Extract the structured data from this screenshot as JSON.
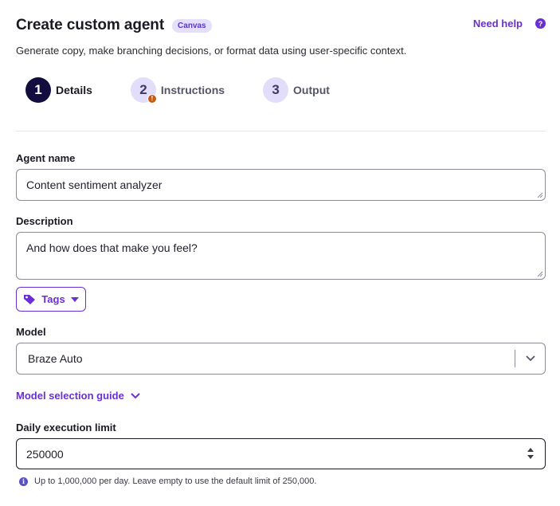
{
  "header": {
    "title": "Create custom agent",
    "badge": "Canvas",
    "help_link": "Need help",
    "help_icon": "?"
  },
  "subtitle": "Generate copy, make branching decisions, or format data using user-specific context.",
  "steps": [
    {
      "number": "1",
      "label": "Details",
      "active": true
    },
    {
      "number": "2",
      "label": "Instructions",
      "active": false,
      "warning": "!"
    },
    {
      "number": "3",
      "label": "Output",
      "active": false
    }
  ],
  "form": {
    "agent_name": {
      "label": "Agent name",
      "value": "Content sentiment analyzer"
    },
    "description": {
      "label": "Description",
      "value": "And how does that make you feel?"
    },
    "tags_button": "Tags",
    "model": {
      "label": "Model",
      "value": "Braze Auto"
    },
    "model_guide_link": "Model selection guide",
    "daily_limit": {
      "label": "Daily execution limit",
      "value": "250000",
      "hint": "Up to 1,000,000 per day. Leave empty to use the default limit of 250,000.",
      "hint_icon": "i"
    }
  },
  "colors": {
    "accent": "#6a2fd4",
    "active_step": "#130c3e",
    "inactive_step": "#e2defa",
    "warning": "#c45c14"
  }
}
